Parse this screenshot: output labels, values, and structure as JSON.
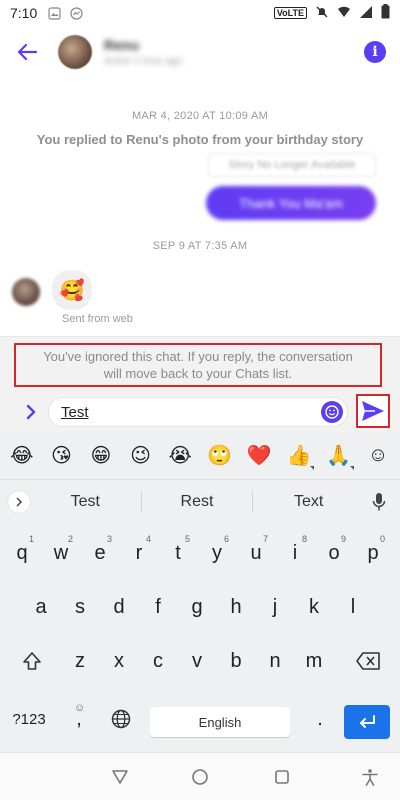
{
  "status_bar": {
    "time": "7:10",
    "volte": "VoLTE"
  },
  "header": {
    "name": "Renu",
    "subtitle": "Active 1 hour ago"
  },
  "messages": {
    "timestamp_1": "MAR 4, 2020 AT 10:09 AM",
    "reply_note": "You replied to Renu's photo from your birthday story",
    "story_ref": "Story No Longer Available",
    "outgoing_text": "Thank You Ma'am",
    "timestamp_2": "SEP 9 AT 7:35 AM",
    "incoming_emoji": "🥰",
    "sent_from": "Sent from web"
  },
  "notice": {
    "line1": "You've ignored this chat. If you reply, the conversation",
    "line2": "will move back to your Chats list."
  },
  "composer": {
    "input_value": "Test"
  },
  "keyboard": {
    "emojis": [
      "😂",
      "😘",
      "😁",
      "😉",
      "😭",
      "🙄",
      "❤️",
      "👍",
      "🙏",
      "☺"
    ],
    "suggestions": [
      "Test",
      "Rest",
      "Text"
    ],
    "row1": [
      "q",
      "w",
      "e",
      "r",
      "t",
      "y",
      "u",
      "i",
      "o",
      "p"
    ],
    "row1_hints": [
      "1",
      "2",
      "3",
      "4",
      "5",
      "6",
      "7",
      "8",
      "9",
      "0"
    ],
    "row2": [
      "a",
      "s",
      "d",
      "f",
      "g",
      "h",
      "j",
      "k",
      "l"
    ],
    "row3": [
      "z",
      "x",
      "c",
      "v",
      "b",
      "n",
      "m"
    ],
    "symbols_label": "?123",
    "emoji_key": "☺",
    "comma": ",",
    "space_label": "English",
    "period": "."
  },
  "colors": {
    "accent": "#5b3df5",
    "highlight": "#d6262b",
    "enter": "#1a73e8"
  }
}
